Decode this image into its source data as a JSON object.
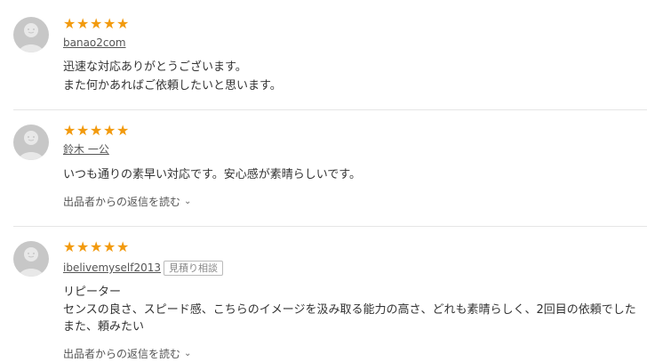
{
  "reviews": [
    {
      "rating": 5,
      "stars": [
        "★",
        "★",
        "★",
        "★",
        "★"
      ],
      "user": "banao2com",
      "badge": "",
      "lines": [
        "迅速な対応ありがとうございます。",
        "また何かあればご依頼したいと思います。"
      ],
      "reply_link": ""
    },
    {
      "rating": 5,
      "stars": [
        "★",
        "★",
        "★",
        "★",
        "★"
      ],
      "user": "鈴木 一公",
      "badge": "",
      "lines": [
        "いつも通りの素早い対応です。安心感が素晴らしいです。"
      ],
      "reply_link": "出品者からの返信を読む"
    },
    {
      "rating": 5,
      "stars": [
        "★",
        "★",
        "★",
        "★",
        "★"
      ],
      "user": "ibelivemyself2013",
      "badge": "見積り相談",
      "lines": [
        "リピーター",
        "センスの良さ、スピード感、こちらのイメージを汲み取る能力の高さ、どれも素晴らしく、2回目の依頼でした",
        "また、頼みたい"
      ],
      "reply_link": "出品者からの返信を読む"
    }
  ],
  "icons": {
    "star": "star-icon",
    "avatar": "user-avatar-icon",
    "chevron": "chevron-down-icon"
  },
  "colors": {
    "star": "#f29a0d",
    "avatar": "#c7c7c7",
    "text": "#333333",
    "divider": "#e5e5e5"
  }
}
